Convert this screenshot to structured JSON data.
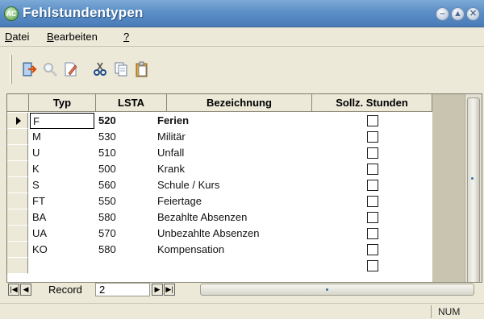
{
  "window": {
    "title": "Fehlstundentypen",
    "app_icon_text": "AC",
    "controls": [
      "minimize-icon",
      "maximize-icon",
      "close-icon"
    ]
  },
  "menu": {
    "items": [
      {
        "label": "Datei",
        "mnemonic": "D"
      },
      {
        "label": "Bearbeiten",
        "mnemonic": "B"
      },
      {
        "label": "?",
        "mnemonic": "?"
      }
    ]
  },
  "toolbar": {
    "icons": [
      "exit-icon",
      "search-icon",
      "edit-document-icon",
      "cut-icon",
      "copy-icon",
      "paste-icon"
    ]
  },
  "grid": {
    "columns": [
      "Typ",
      "LSTA",
      "Bezeichnung",
      "Sollz. Stunden"
    ],
    "rows": [
      {
        "typ": "F",
        "lsta": "520",
        "bezeichnung": "Ferien",
        "sollz": false,
        "current": true
      },
      {
        "typ": "M",
        "lsta": "530",
        "bezeichnung": "Militär",
        "sollz": false,
        "current": false
      },
      {
        "typ": "U",
        "lsta": "510",
        "bezeichnung": "Unfall",
        "sollz": false,
        "current": false
      },
      {
        "typ": "K",
        "lsta": "500",
        "bezeichnung": "Krank",
        "sollz": false,
        "current": false
      },
      {
        "typ": "S",
        "lsta": "560",
        "bezeichnung": "Schule / Kurs",
        "sollz": false,
        "current": false
      },
      {
        "typ": "FT",
        "lsta": "550",
        "bezeichnung": "Feiertage",
        "sollz": false,
        "current": false
      },
      {
        "typ": "BA",
        "lsta": "580",
        "bezeichnung": "Bezahlte Absenzen",
        "sollz": false,
        "current": false
      },
      {
        "typ": "UA",
        "lsta": "570",
        "bezeichnung": "Unbezahlte Absenzen",
        "sollz": false,
        "current": false
      },
      {
        "typ": "KO",
        "lsta": "580",
        "bezeichnung": "Kompensation",
        "sollz": false,
        "current": false
      },
      {
        "typ": "",
        "lsta": "",
        "bezeichnung": "",
        "sollz": false,
        "current": false
      }
    ]
  },
  "navigator": {
    "label": "Record",
    "value": "2"
  },
  "status": {
    "indicator": "NUM"
  }
}
